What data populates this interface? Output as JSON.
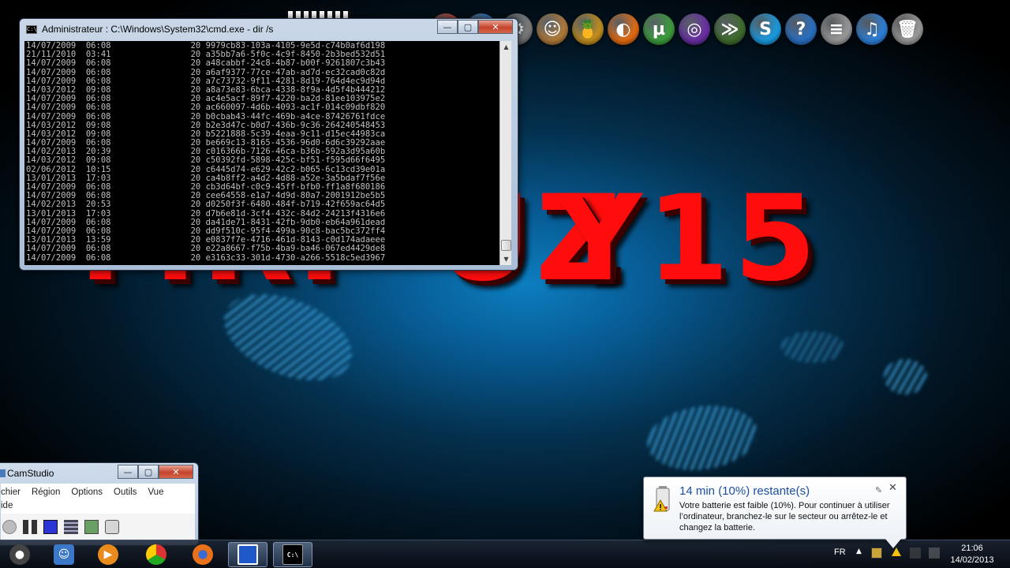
{
  "wallpaper": {
    "text_left": "MRP UZ",
    "text_right": "Y15"
  },
  "cmd": {
    "title": "Administrateur : C:\\Windows\\System32\\cmd.exe - dir /s",
    "icon_label": "C:\\",
    "lines": [
      "14/07/2009  06:08                20 9979cb83-103a-4105-9e5d-c74b0af6d198",
      "21/11/2010  03:41                20 a35bb7a6-5f0c-4c9f-8450-2b3bed532d51",
      "14/07/2009  06:08                20 a48cabbf-24c8-4b87-b00f-9261807c3b43",
      "14/07/2009  06:08                20 a6af9377-77ce-47ab-ad7d-ec32cad0c82d",
      "14/07/2009  06:08                20 a7c73732-9f11-4281-8d19-764d4ec9d94d",
      "14/03/2012  09:08                20 a8a73e83-6bca-4338-8f9a-4d5f4b444212",
      "14/07/2009  06:08                20 ac4e5acf-89f7-4220-ba2d-81ee103975e2",
      "14/07/2009  06:08                20 ac660097-4d6b-4093-ac1f-014c09dbf820",
      "14/07/2009  06:08                20 b0cbab43-44fc-469b-a4ce-87426761fdce",
      "14/03/2012  09:08                20 b2e3d47c-b0d7-436b-9c36-264240548453",
      "14/03/2012  09:08                20 b5221888-5c39-4eaa-9c11-d15ec44983ca",
      "14/07/2009  06:08                20 be669c13-8165-4536-96d0-6d6c39292aae",
      "14/02/2013  20:39                20 c016366b-7126-46ca-b36b-592a3d95a60b",
      "14/03/2012  09:08                20 c50392fd-5898-425c-bf51-f595d66f6495",
      "02/06/2012  10:15                20 c6445d74-e629-42c2-b065-6c13cd39e01a",
      "13/01/2013  17:03                20 ca4b8ff2-a4d2-4d88-a52e-3a5bdaf7f56e",
      "14/07/2009  06:08                20 cb3d64bf-c0c9-45ff-bfb0-ff1a8f680186",
      "14/07/2009  06:08                20 cee64558-e1a7-4d9d-80a7-2001912be5b5",
      "14/02/2013  20:53                20 d0250f3f-6480-484f-b719-42f659ac64d5",
      "13/01/2013  17:03                20 d7b6e81d-3cf4-432c-84d2-24213f4316e6",
      "14/07/2009  06:08                20 da41de71-8431-42fb-9db0-eb64a961dead",
      "14/07/2009  06:08                20 dd9f510c-95f4-499a-90c8-bac5bc372ff4",
      "13/01/2013  13:59                20 e0837f7e-4716-461d-8143-c0d174adaeee",
      "14/07/2009  06:08                20 e22a8667-f75b-4ba9-ba46-067ed4429de8",
      "14/07/2009  06:08                20 e3163c33-301d-4730-a266-5518c5ed3967"
    ],
    "btn_minimize": "—",
    "btn_maximize": "▢",
    "btn_close": "✕",
    "scroll_up": "▲",
    "scroll_down": "▼"
  },
  "camstudio": {
    "title": "CamStudio",
    "menu": [
      "chier",
      "Région",
      "Options",
      "Outils",
      "Vue"
    ],
    "menu_row2": "ide",
    "btn_minimize": "—",
    "btn_maximize": "▢",
    "btn_close": "✕"
  },
  "notification": {
    "title": "14 min (10%) restante(s)",
    "text": "Votre batterie est faible (10%). Pour continuer à utiliser l’ordinateur, branchez-le sur le secteur ou arrêtez-le et changez la batterie.",
    "close": "✕",
    "pin": "✎"
  },
  "taskbar": {
    "language": "FR",
    "tray_arrow": "▲",
    "time": "21:06",
    "date": "14/02/2013",
    "cmd_label": "C:\\"
  },
  "dock_icons": [
    {
      "name": "chrome-icon",
      "glyph": "◉",
      "color": "#d23c2f"
    },
    {
      "name": "itunes-icon",
      "glyph": "♫",
      "color": "#2d7fd8"
    },
    {
      "name": "system-preferences-icon",
      "glyph": "⚙",
      "color": "#7c7c7c"
    },
    {
      "name": "user-avatar-icon",
      "glyph": "☺",
      "color": "#b07a3a"
    },
    {
      "name": "cocktail-icon",
      "glyph": "🍍",
      "color": "#c28e1e"
    },
    {
      "name": "firefox-icon",
      "glyph": "◐",
      "color": "#e46b12"
    },
    {
      "name": "utorrent-icon",
      "glyph": "µ",
      "color": "#3c9d3c"
    },
    {
      "name": "bittorrent-icon",
      "glyph": "◎",
      "color": "#6a2fa3"
    },
    {
      "name": "terminal-icon",
      "glyph": "≫",
      "color": "#3e6b2d"
    },
    {
      "name": "skype-icon",
      "glyph": "S",
      "color": "#1b9be0"
    },
    {
      "name": "help-icon",
      "glyph": "?",
      "color": "#2a6fc2"
    },
    {
      "name": "stack-icon",
      "glyph": "≡",
      "color": "#9a9a9a"
    },
    {
      "name": "itunes-icon-2",
      "glyph": "♫",
      "color": "#2d7fd8"
    },
    {
      "name": "trash-icon",
      "glyph": "🗑",
      "color": "#9a9a9a"
    }
  ],
  "colors": {
    "wall_red": "#ff0d0d",
    "cmd_bg": "#000000",
    "cmd_fg": "#c0c0c0",
    "notif_title": "#1b4e9e"
  }
}
